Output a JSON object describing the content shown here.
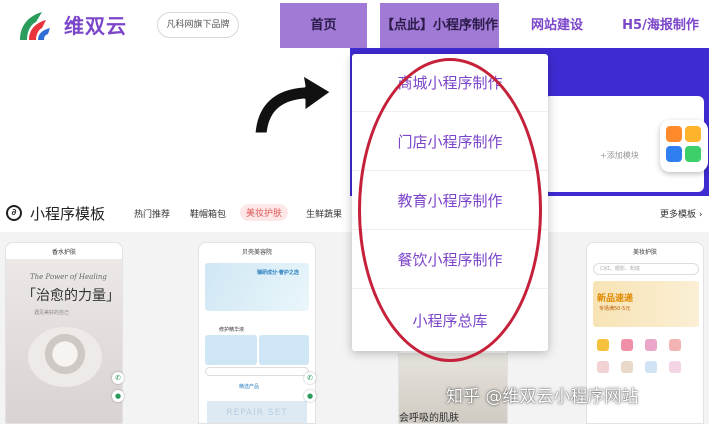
{
  "header": {
    "brand": "维双云",
    "slogan": "凡科网旗下品牌",
    "nav": [
      {
        "label": "首页"
      },
      {
        "label": "【点此】小程序制作"
      },
      {
        "label": "网站建设"
      },
      {
        "label": "H5/海报制作"
      }
    ]
  },
  "banner": {
    "add_module": "+添加模块"
  },
  "dropdown": {
    "items": [
      {
        "label": "商城小程序制作"
      },
      {
        "label": "门店小程序制作"
      },
      {
        "label": "教育小程序制作"
      },
      {
        "label": "餐饮小程序制作"
      },
      {
        "label": "小程序总库"
      }
    ]
  },
  "templates": {
    "title": "小程序模板",
    "categories": [
      {
        "label": "热门推荐"
      },
      {
        "label": "鞋帽箱包"
      },
      {
        "label": "美妆护肤"
      },
      {
        "label": "生鲜蔬果"
      }
    ],
    "active_category": "美妆护肤",
    "more": "更多模板 ›"
  },
  "phones": [
    {
      "title": "香水护肤",
      "en_tagline": "The Power of Healing",
      "cn_tagline": "「治愈的力量」",
      "sub": "遇见美好的自己"
    },
    {
      "title": "贝壳美容院",
      "banner_text": "臻研成分·奢护之选",
      "tag": "修护精华液",
      "section": "精选产品",
      "footer": "REPAIR SET"
    },
    {
      "title": "",
      "text": "会呼吸的肌肤"
    },
    {
      "title": "美妆护肤",
      "search": "口红、眼影、粉底",
      "banner_title": "新品速递",
      "banner_sub": "专场满50-5元"
    }
  ],
  "watermark": "知乎 @维双云小程序网站",
  "colors": {
    "brand_purple": "#7b45c9",
    "nav_active_bg": "#a07ad4",
    "banner_blue": "#3e2bd2",
    "ellipse_red": "#c6213a"
  }
}
